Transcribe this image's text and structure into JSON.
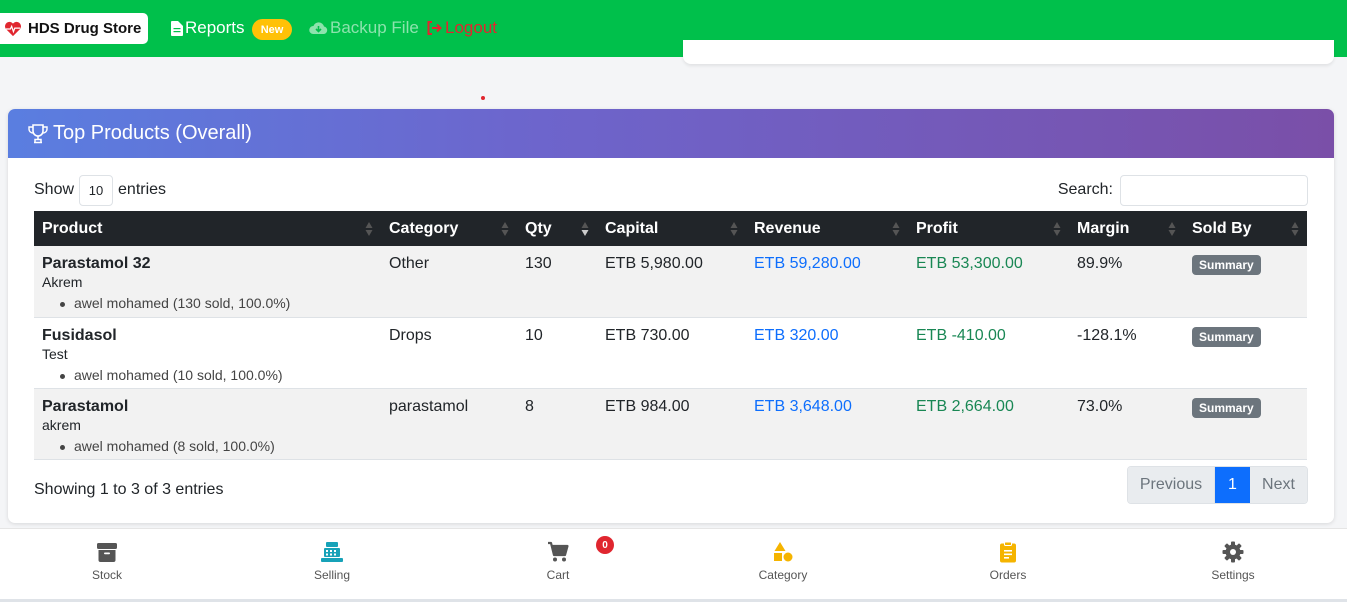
{
  "navbar": {
    "brand": "HDS Drug Store",
    "reports": "Reports",
    "new_badge": "New",
    "backup": "Backup File",
    "logout": "Logout",
    "bg_color": "#00c04b"
  },
  "card": {
    "title": "Top Products (Overall)",
    "show_label": "Show",
    "entries_value": "10",
    "entries_label": "entries",
    "search_label": "Search:",
    "search_value": ""
  },
  "table": {
    "headers": [
      "Product",
      "Category",
      "Qty",
      "Capital",
      "Revenue",
      "Profit",
      "Margin",
      "Sold By"
    ],
    "rows": [
      {
        "product": "Parastamol 32",
        "sub": "Akrem",
        "seller": "awel mohamed (130 sold, 100.0%)",
        "category": "Other",
        "qty": "130",
        "capital": "ETB 5,980.00",
        "revenue": "ETB 59,280.00",
        "profit": "ETB 53,300.00",
        "margin": "89.9%",
        "action": "Summary"
      },
      {
        "product": "Fusidasol",
        "sub": "Test",
        "seller": "awel mohamed (10 sold, 100.0%)",
        "category": "Drops",
        "qty": "10",
        "capital": "ETB 730.00",
        "revenue": "ETB 320.00",
        "profit": "ETB -410.00",
        "margin": "-128.1%",
        "action": "Summary"
      },
      {
        "product": "Parastamol",
        "sub": "akrem",
        "seller": "awel mohamed (8 sold, 100.0%)",
        "category": "parastamol",
        "qty": "8",
        "capital": "ETB 984.00",
        "revenue": "ETB 3,648.00",
        "profit": "ETB 2,664.00",
        "margin": "73.0%",
        "action": "Summary"
      }
    ]
  },
  "footer": {
    "info": "Showing 1 to 3 of 3 entries",
    "prev": "Previous",
    "page": "1",
    "next": "Next"
  },
  "bottom_nav": {
    "items": [
      "Stock",
      "Selling",
      "Cart",
      "Category",
      "Orders",
      "Settings"
    ],
    "cart_count": "0"
  }
}
